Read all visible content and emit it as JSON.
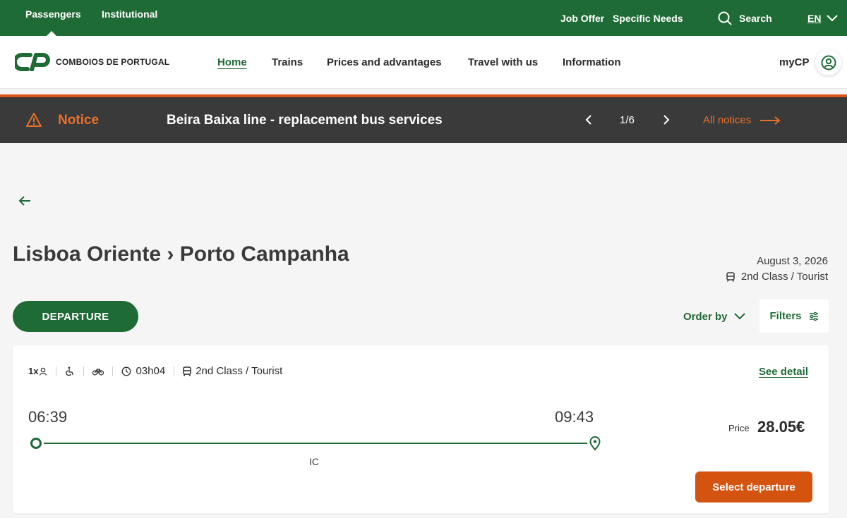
{
  "topbar": {
    "passengers": "Passengers",
    "institutional": "Institutional",
    "job_offer": "Job Offer",
    "specific_needs": "Specific Needs",
    "search": "Search",
    "lang": "EN"
  },
  "logo": {
    "text": "COMBOIOS DE PORTUGAL"
  },
  "nav": {
    "home": "Home",
    "trains": "Trains",
    "prices": "Prices and advantages",
    "travel": "Travel with us",
    "information": "Information",
    "mycp": "myCP"
  },
  "notice": {
    "label": "Notice",
    "text": "Beira Baixa line - replacement bus services",
    "counter": "1/6",
    "all": "All notices"
  },
  "trip": {
    "title": "Lisboa Oriente › Porto Campanha",
    "date": "August 3, 2026",
    "class": "2nd Class / Tourist"
  },
  "controls": {
    "departure": "DEPARTURE",
    "order_by": "Order by",
    "filters": "Filters"
  },
  "card": {
    "passengers": "1x",
    "duration": "03h04",
    "class": "2nd Class / Tourist",
    "see_detail": "See detail",
    "departure_time": "06:39",
    "arrival_time": "09:43",
    "train_type": "IC",
    "price_label": "Price",
    "price": "28.05€",
    "select": "Select departure"
  },
  "colors": {
    "brand_green": "#1f6b35",
    "accent_orange": "#d4540f",
    "notice_bg": "#3a3a3a"
  }
}
